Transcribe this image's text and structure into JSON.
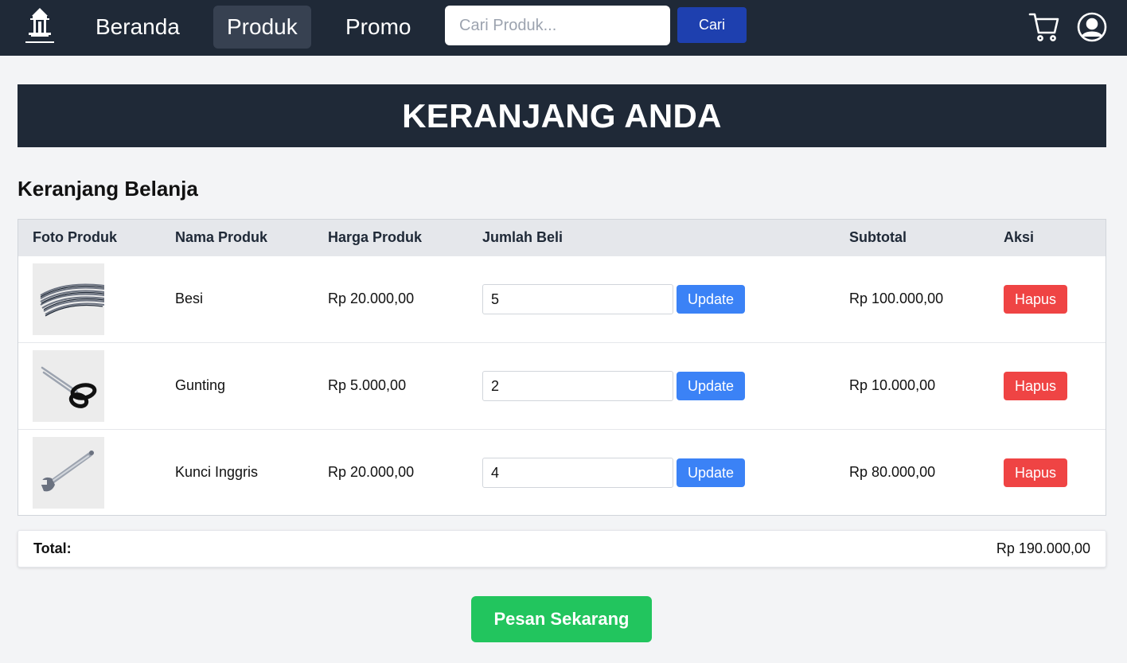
{
  "nav": {
    "logo_name": "logo-icon",
    "links": [
      {
        "label": "Beranda"
      },
      {
        "label": "Produk"
      },
      {
        "label": "Promo"
      }
    ],
    "search_placeholder": "Cari Produk...",
    "search_button": "Cari",
    "icons": [
      "cart-icon",
      "user-icon"
    ]
  },
  "banner": {
    "title": "KERANJANG ANDA"
  },
  "cart": {
    "section_title": "Keranjang Belanja",
    "columns": [
      "Foto Produk",
      "Nama Produk",
      "Harga Produk",
      "Jumlah Beli",
      "Subtotal",
      "Aksi"
    ],
    "items": [
      {
        "name": "Besi",
        "price": "Rp 20.000,00",
        "qty": "5",
        "subtotal": "Rp 100.000,00",
        "update_label": "Update",
        "delete_label": "Hapus"
      },
      {
        "name": "Gunting",
        "price": "Rp 5.000,00",
        "qty": "2",
        "subtotal": "Rp 10.000,00",
        "update_label": "Update",
        "delete_label": "Hapus"
      },
      {
        "name": "Kunci Inggris",
        "price": "Rp 20.000,00",
        "qty": "4",
        "subtotal": "Rp 80.000,00",
        "update_label": "Update",
        "delete_label": "Hapus"
      }
    ],
    "total_label": "Total:",
    "total_value": "Rp 190.000,00",
    "order_button": "Pesan Sekarang"
  },
  "colors": {
    "navbar": "#1f2937",
    "update": "#3b82f6",
    "delete": "#ef4444",
    "order": "#22c55e",
    "search_button": "#1e40af"
  }
}
